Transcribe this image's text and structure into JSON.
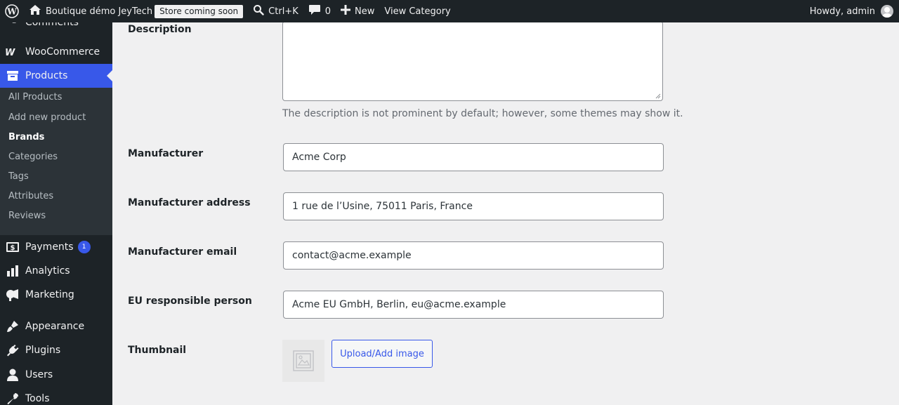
{
  "adminbar": {
    "site_name": "Boutique démo JeyTech",
    "store_badge": "Store coming soon",
    "search_shortcut": "Ctrl+K",
    "comments_count": "0",
    "new_label": "New",
    "view_category": "View Category",
    "howdy": "Howdy, admin"
  },
  "sidebar": {
    "partial_item": "Comments",
    "woocommerce": "WooCommerce",
    "products": "Products",
    "submenu": [
      "All Products",
      "Add new product",
      "Brands",
      "Categories",
      "Tags",
      "Attributes",
      "Reviews"
    ],
    "payments": "Payments",
    "payments_badge": "1",
    "analytics": "Analytics",
    "marketing": "Marketing",
    "appearance": "Appearance",
    "plugins": "Plugins",
    "users": "Users",
    "tools": "Tools"
  },
  "form": {
    "description_label": "Description",
    "description_help": "The description is not prominent by default; however, some themes may show it.",
    "manufacturer_label": "Manufacturer",
    "manufacturer_value": "Acme Corp",
    "manufacturer_address_label": "Manufacturer address",
    "manufacturer_address_value": "1 rue de l’Usine, 75011 Paris, France",
    "manufacturer_email_label": "Manufacturer email",
    "manufacturer_email_value": "contact@acme.example",
    "eu_person_label": "EU responsible person",
    "eu_person_value": "Acme EU GmbH, Berlin, eu@acme.example",
    "thumbnail_label": "Thumbnail",
    "upload_button": "Upload/Add image"
  },
  "colors": {
    "accent": "#3858e9",
    "adminbar_bg": "#1d2327",
    "page_bg": "#f0f0f1"
  }
}
